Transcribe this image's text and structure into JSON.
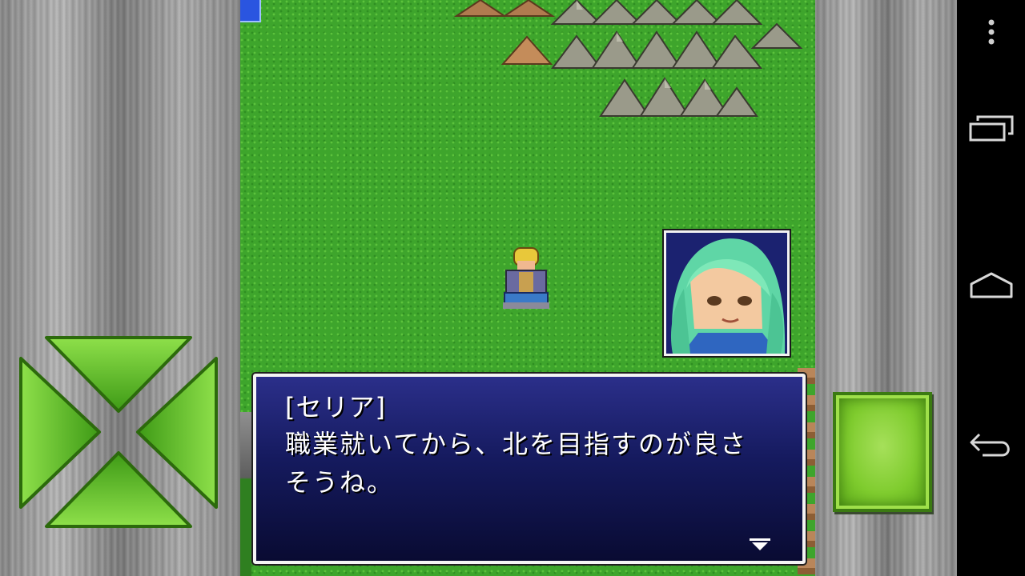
{
  "dialog": {
    "speaker": "[セリア]",
    "lines": [
      "職業就いてから、北を目指すのが良さ",
      "そうね。"
    ],
    "advance_indicator": "down-triangle-icon"
  },
  "portrait": {
    "character_icon": "green-haired-girl-portrait"
  },
  "controls": {
    "dpad_icon": "green-dpad",
    "action_button_icon": "green-square-button"
  },
  "system_nav": {
    "menu_icon": "overflow-menu-icon",
    "recent_icon": "recent-apps-icon",
    "home_icon": "home-icon",
    "back_icon": "back-icon"
  },
  "colors": {
    "grass": "#3ea52c",
    "dialog_top": "#2b2f8a",
    "dialog_bottom": "#090b32",
    "control_green": "#7fcc2e"
  }
}
